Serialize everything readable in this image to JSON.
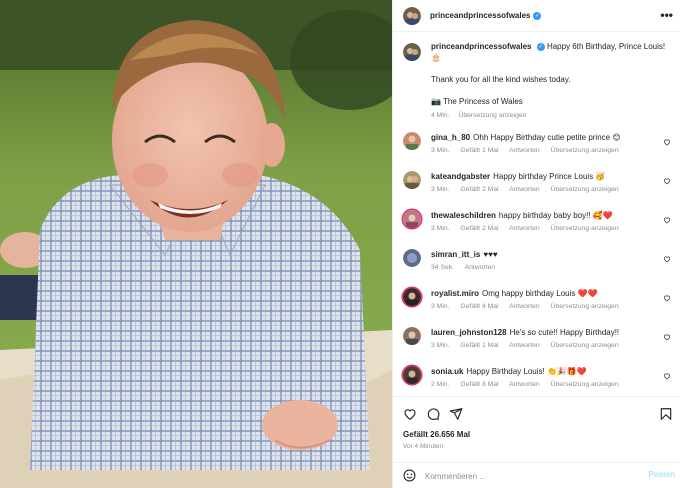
{
  "post": {
    "username": "princeandprincessofwales",
    "verified": true,
    "caption": {
      "username": "princeandprincessofwales",
      "line1": "Happy 6th Birthday, Prince Louis! 🎂",
      "line2": "Thank you for all the kind wishes today.",
      "credit": "📷 The Princess of Wales",
      "time": "4 Min.",
      "translate": "Übersetzung anzeigen"
    }
  },
  "comments": [
    {
      "username": "gina_h_80",
      "text": "Ohh Happy Birthday cutie petite prince 😊",
      "time": "3 Min.",
      "likes": "Gefällt 1 Mal",
      "reply": "Antworten",
      "translate": "Übersetzung anzeigen",
      "avatar_color": "#c78a6b"
    },
    {
      "username": "kateandgabster",
      "text": "Happy birthday Prince Louis 🥳",
      "time": "3 Min.",
      "likes": "Gefällt 2 Mal",
      "reply": "Antworten",
      "translate": "Übersetzung anzeigen",
      "avatar_color": "#a89a6a"
    },
    {
      "username": "thewaleschildren",
      "text": "happy birthday baby boy!! 🥰❤️",
      "time": "3 Min.",
      "likes": "Gefällt 2 Mal",
      "reply": "Antworten",
      "translate": "Übersetzung anzeigen",
      "avatar_color": "#b77b8a",
      "ring": true
    },
    {
      "username": "simran_itt_is",
      "text": "♥♥♥",
      "time": "34 Sek.",
      "likes": "",
      "reply": "Antworten",
      "translate": "",
      "avatar_color": "#5b6b8c"
    },
    {
      "username": "royalist.miro",
      "text": "Omg happy birthday Louis ❤️❤️",
      "time": "3 Min.",
      "likes": "Gefällt 4 Mal",
      "reply": "Antworten",
      "translate": "Übersetzung anzeigen",
      "avatar_color": "#3a2a2a",
      "ring": true
    },
    {
      "username": "lauren_johnston128",
      "text": "He's so cute!! Happy Birthday!!",
      "time": "3 Min.",
      "likes": "Gefällt 1 Mal",
      "reply": "Antworten",
      "translate": "Übersetzung anzeigen",
      "avatar_color": "#8a7060"
    },
    {
      "username": "sonia.uk",
      "text": "Happy Birthday Louis! 👏🎉🎁❤️",
      "time": "2 Min.",
      "likes": "Gefällt 8 Mal",
      "reply": "Antworten",
      "translate": "Übersetzung anzeigen",
      "avatar_color": "#4a3a30",
      "ring": true
    }
  ],
  "actions": {
    "likes": "Gefällt 26.656 Mal",
    "ago": "Vor 4 Minuten"
  },
  "composer": {
    "placeholder": "Kommentieren ...",
    "post_label": "Posten"
  },
  "colors": {
    "verified": "#3897f0",
    "muted": "#8e8e8e",
    "text": "#262626",
    "post_button": "#b2dffc"
  }
}
